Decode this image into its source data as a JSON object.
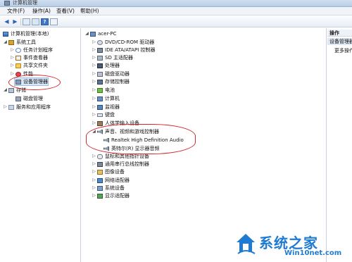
{
  "window": {
    "title": "计算机管理"
  },
  "menu": [
    {
      "label": "文件(F)"
    },
    {
      "label": "操作(A)"
    },
    {
      "label": "查看(V)"
    },
    {
      "label": "帮助(H)"
    }
  ],
  "toolbar": {
    "help_glyph": "?"
  },
  "left_tree": {
    "root": "计算机管理(本地)",
    "items": [
      {
        "label": "系统工具",
        "icon": "tools-icon"
      },
      {
        "label": "任务计划程序",
        "icon": "clock-icon"
      },
      {
        "label": "事件查看器",
        "icon": "event-log-icon"
      },
      {
        "label": "共享文件夹",
        "icon": "shared-folder-icon"
      },
      {
        "label": "性能",
        "icon": "performance-icon"
      },
      {
        "label": "设备管理器",
        "icon": "device-manager-icon"
      },
      {
        "label": "存储",
        "icon": "storage-icon"
      },
      {
        "label": "磁盘管理",
        "icon": "disk-icon"
      },
      {
        "label": "服务和应用程序",
        "icon": "services-icon"
      }
    ]
  },
  "device_tree": {
    "root": "acer-PC",
    "categories": [
      {
        "label": "DVD/CD-ROM 驱动器",
        "icon": "dvd-icon"
      },
      {
        "label": "IDE ATA/ATAPI 控制器",
        "icon": "ide-controller-icon"
      },
      {
        "label": "SD 主适配器",
        "icon": "sd-adapter-icon"
      },
      {
        "label": "处理器",
        "icon": "processor-icon"
      },
      {
        "label": "磁盘驱动器",
        "icon": "disk-drive-icon"
      },
      {
        "label": "存储控制器",
        "icon": "storage-controller-icon"
      },
      {
        "label": "电池",
        "icon": "battery-icon"
      },
      {
        "label": "计算机",
        "icon": "computer-icon"
      },
      {
        "label": "监视器",
        "icon": "monitor-icon"
      },
      {
        "label": "键盘",
        "icon": "keyboard-icon"
      },
      {
        "label": "人体学输入设备",
        "icon": "hid-icon"
      },
      {
        "label": "声音、视频和游戏控制器",
        "icon": "speaker-icon"
      },
      {
        "label": "Realtek High Definition Audio",
        "icon": "speaker-icon"
      },
      {
        "label": "英特尔(R) 显示器音频",
        "icon": "speaker-icon"
      },
      {
        "label": "鼠标和其他指针设备",
        "icon": "mouse-icon"
      },
      {
        "label": "通用串行总线控制器",
        "icon": "usb-icon"
      },
      {
        "label": "图像设备",
        "icon": "imaging-icon"
      },
      {
        "label": "网络适配器",
        "icon": "network-icon"
      },
      {
        "label": "系统设备",
        "icon": "system-icon"
      },
      {
        "label": "显示适配器",
        "icon": "display-adapter-icon"
      }
    ]
  },
  "actions": {
    "header": "操作",
    "selected": "设备管理器",
    "more": "更多操作"
  },
  "watermark": {
    "brand": "系统之家",
    "site": "Win10net.com"
  },
  "colors": {
    "annotation": "#d1262c",
    "watermark": "#1e7bd1",
    "selection": "#d8e6f6"
  }
}
